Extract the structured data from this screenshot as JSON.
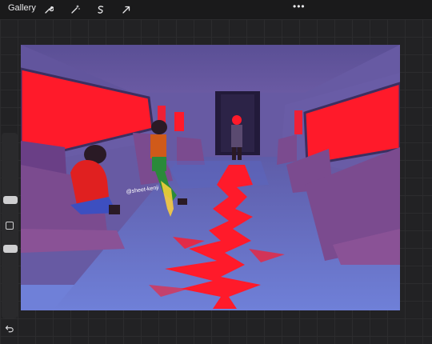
{
  "toolbar": {
    "gallery_label": "Gallery",
    "tools": [
      "wrench-icon",
      "magic-wand-icon",
      "selection-icon",
      "transform-arrow-icon"
    ],
    "more_label": "•••"
  },
  "sidebar": {
    "brush_size_level": 0.2,
    "opacity_level": 0.55
  },
  "canvas": {
    "signature": "@sheet-kenji"
  },
  "colors": {
    "accent_red": "#ff1a2a",
    "wall_purple": "#6e5fa8",
    "floor_blue": "#6f7fd6"
  }
}
